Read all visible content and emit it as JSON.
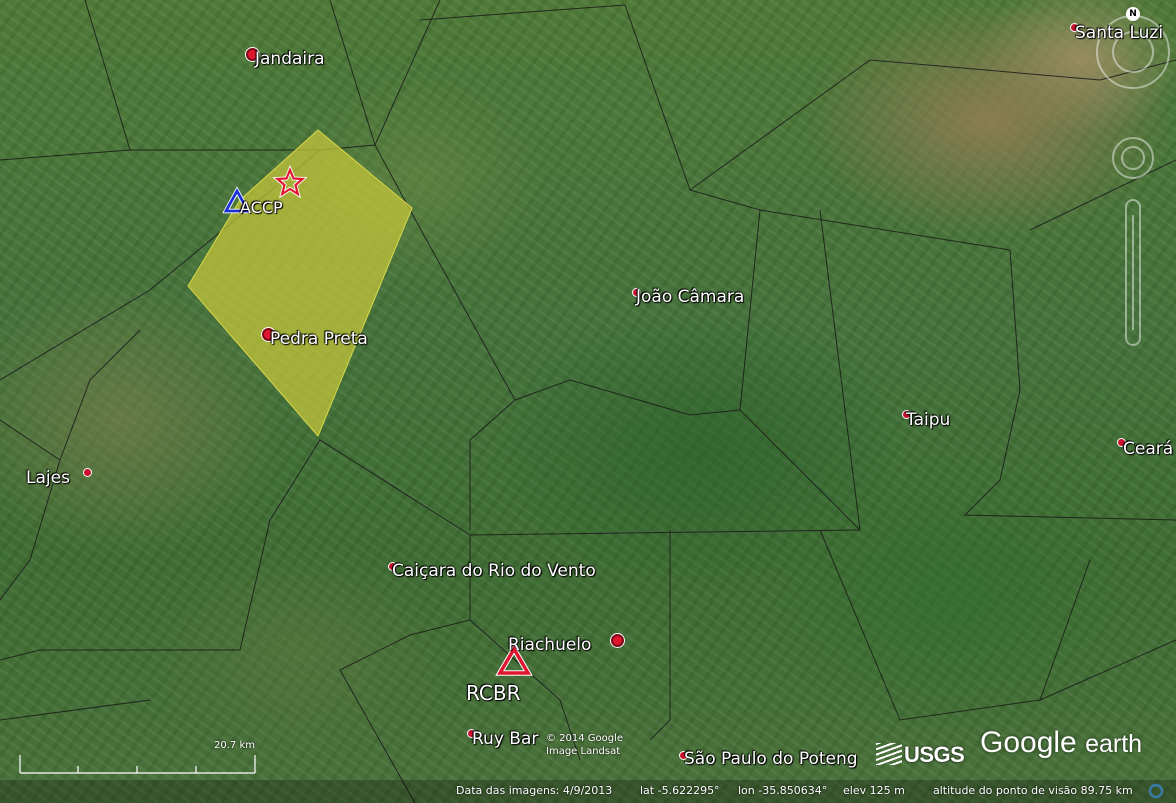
{
  "places": [
    {
      "id": "jandaira",
      "label": "Jandaira"
    },
    {
      "id": "santa-luzia",
      "label": "Santa Luzi"
    },
    {
      "id": "joao-camara",
      "label": "João Câmara"
    },
    {
      "id": "pedra-preta",
      "label": "Pedra Preta"
    },
    {
      "id": "taipu",
      "label": "Taipu"
    },
    {
      "id": "ceara",
      "label": "Ceará"
    },
    {
      "id": "lajes",
      "label": "Lajes"
    },
    {
      "id": "caicara",
      "label": "Caiçara do Rio do Vento"
    },
    {
      "id": "riachuelo",
      "label": "Riachuelo"
    },
    {
      "id": "ruy-barbosa",
      "label": "Ruy Bar"
    },
    {
      "id": "sao-paulo",
      "label": "São Paulo do Poteng"
    }
  ],
  "stations": {
    "accp": {
      "label": "ACCP",
      "color": "#1a2fd6"
    },
    "rcbr": {
      "label": "RCBR",
      "color": "#e0152f"
    }
  },
  "epicenter": {
    "icon": "star-icon",
    "color": "#e0152f"
  },
  "region": {
    "fill": "#c8c83a",
    "stroke": "#e6e64a"
  },
  "scale": {
    "label": "20.7 km"
  },
  "imagery": {
    "copyright": "© 2014 Google",
    "source": "Image Landsat",
    "provider": "USGS"
  },
  "status_bar": {
    "date": "Data das imagens: 4/9/2013",
    "lat": "lat   -5.622295°",
    "lon": "lon   -35.850634°",
    "elev": "elev   125 m",
    "eye_alt": "altitude do ponto de visão   89.75 km"
  },
  "branding": {
    "brand": "Google",
    "product": "earth"
  },
  "compass": {
    "north": "N"
  }
}
